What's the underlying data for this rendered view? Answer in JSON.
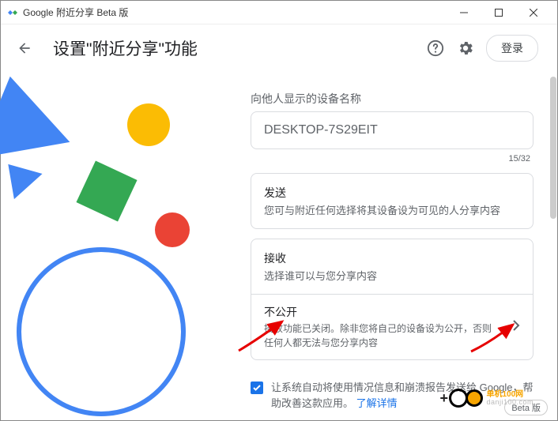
{
  "window": {
    "title": "Google 附近分享 Beta 版"
  },
  "header": {
    "title": "设置\"附近分享\"功能",
    "signin": "登录"
  },
  "device_name": {
    "label": "向他人显示的设备名称",
    "value": "DESKTOP-7S29EIT",
    "counter": "15/32"
  },
  "send": {
    "title": "发送",
    "sub": "您可与附近任何选择将其设备设为可见的人分享内容"
  },
  "receive": {
    "title": "接收",
    "sub": "选择谁可以与您分享内容",
    "option_title": "不公开",
    "option_sub": "接收功能已关闭。除非您将自己的设备设为公开，否则任何人都无法与您分享内容"
  },
  "footer": {
    "text": "让系统自动将使用情况信息和崩溃报告发送给 Google，帮助改善这款应用。",
    "link": "了解详情"
  },
  "badge": "Beta 版",
  "watermark": {
    "line1": "单机100网",
    "line2": "danji100.com"
  }
}
